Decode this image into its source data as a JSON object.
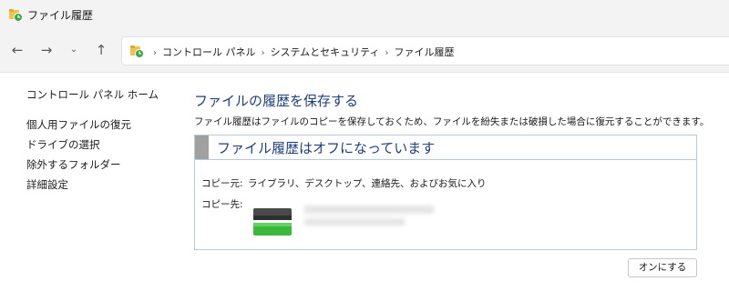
{
  "window": {
    "title": "ファイル履歴"
  },
  "nav": {
    "back_icon": "arrow-left-icon",
    "forward_icon": "arrow-right-icon",
    "recent_icon": "chevron-down-icon",
    "up_icon": "arrow-up-icon"
  },
  "address": {
    "segments": [
      "コントロール パネル",
      "システムとセキュリティ",
      "ファイル履歴"
    ]
  },
  "sidebar": {
    "home": "コントロール パネル ホーム",
    "items": [
      {
        "label": "個人用ファイルの復元"
      },
      {
        "label": "ドライブの選択"
      },
      {
        "label": "除外するフォルダー"
      },
      {
        "label": "詳細設定"
      }
    ]
  },
  "main": {
    "heading": "ファイルの履歴を保存する",
    "description": "ファイル履歴はファイルのコピーを保存しておくため、ファイルを紛失または破損した場合に復元することができます。",
    "status_title": "ファイル履歴はオフになっています",
    "copy_from_label": "コピー元:",
    "copy_from_value": "ライブラリ、デスクトップ、連絡先、およびお気に入り",
    "copy_to_label": "コピー先:",
    "turn_on_button": "オンにする"
  },
  "colors": {
    "heading": "#1e3f80",
    "panel_border": "#b8c8de",
    "drive_green": "#3cb93c"
  }
}
